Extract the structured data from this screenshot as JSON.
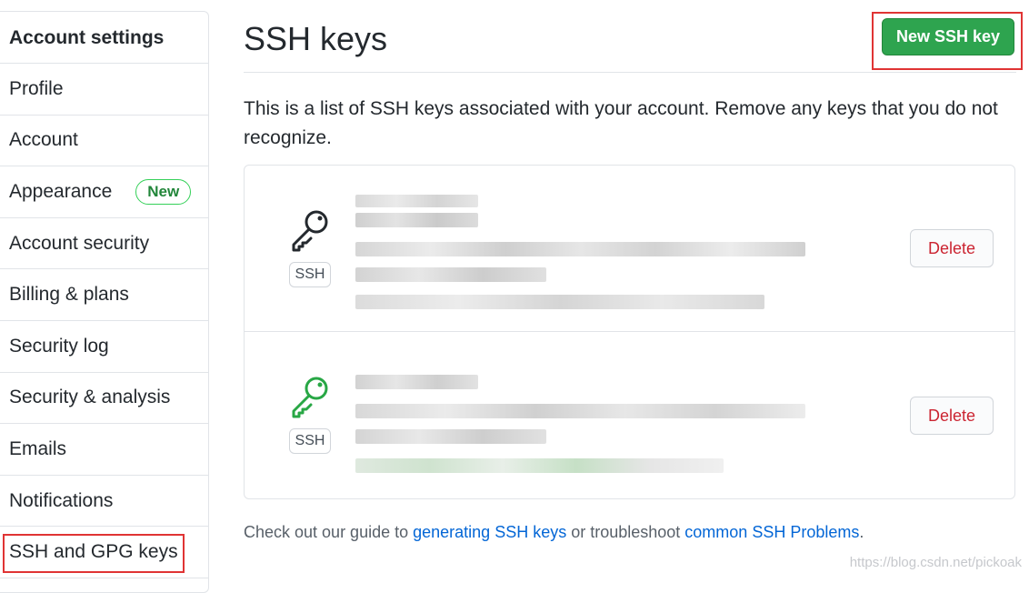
{
  "sidebar": {
    "header": "Account settings",
    "items": [
      {
        "label": "Profile"
      },
      {
        "label": "Account"
      },
      {
        "label": "Appearance",
        "badge": "New"
      },
      {
        "label": "Account security"
      },
      {
        "label": "Billing & plans"
      },
      {
        "label": "Security log"
      },
      {
        "label": "Security & analysis"
      },
      {
        "label": "Emails"
      },
      {
        "label": "Notifications"
      },
      {
        "label": "SSH and GPG keys",
        "selected": true
      }
    ]
  },
  "main": {
    "title": "SSH keys",
    "new_button": "New SSH key",
    "intro": "This is a list of SSH keys associated with your account. Remove any keys that you do not recognize.",
    "keys": [
      {
        "type_label": "SSH",
        "delete_label": "Delete",
        "icon_color": "#24292e"
      },
      {
        "type_label": "SSH",
        "delete_label": "Delete",
        "icon_color": "#28a745"
      }
    ],
    "footer": {
      "prefix": "Check out our guide to ",
      "link1": "generating SSH keys",
      "middle": " or troubleshoot ",
      "link2": "common SSH Problems",
      "suffix": "."
    }
  },
  "watermark": "https://blog.csdn.net/pickoak",
  "colors": {
    "primary_button": "#2ea44f",
    "danger_text": "#cb2431",
    "link": "#0366d6",
    "highlight_frame": "#e03434"
  }
}
